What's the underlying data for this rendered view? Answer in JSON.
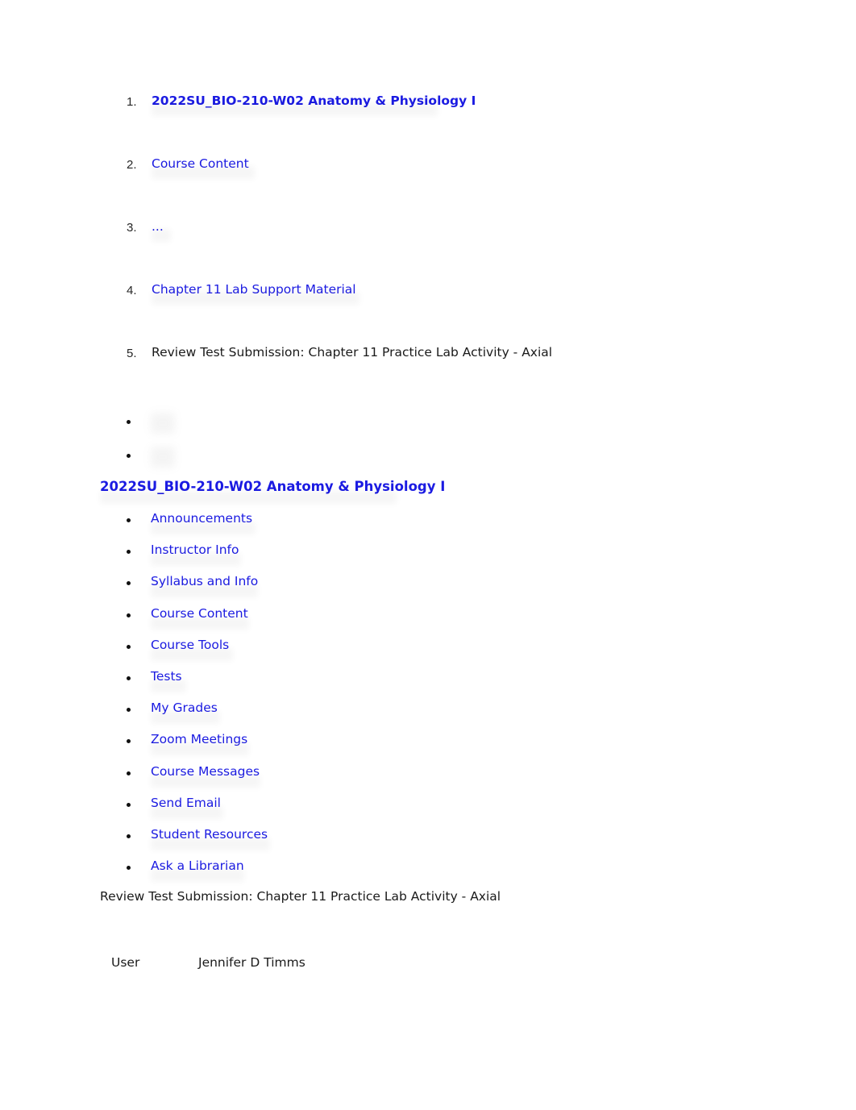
{
  "breadcrumb": {
    "items": [
      {
        "marker": "1.",
        "label": "2022SU_BIO-210-W02 Anatomy & Physiology I",
        "style": "link-bold"
      },
      {
        "marker": "2.",
        "label": "Course Content",
        "style": "link"
      },
      {
        "marker": "3.",
        "label": "...",
        "style": "link"
      },
      {
        "marker": "4.",
        "label": "Chapter 11 Lab Support Material",
        "style": "link"
      },
      {
        "marker": "5.",
        "label": "Review Test Submission: Chapter 11 Practice Lab Activity - Axial",
        "style": "plain"
      }
    ]
  },
  "image_bullets": [
    {
      "icon": "blurred-image-placeholder",
      "label": ""
    },
    {
      "icon": "blurred-image-placeholder",
      "label": ""
    }
  ],
  "course": {
    "heading": "2022SU_BIO-210-W02 Anatomy & Physiology I",
    "menu": [
      {
        "label": "Announcements"
      },
      {
        "label": "Instructor Info"
      },
      {
        "label": "Syllabus and Info"
      },
      {
        "label": "Course Content"
      },
      {
        "label": "Course Tools"
      },
      {
        "label": "Tests"
      },
      {
        "label": "My Grades"
      },
      {
        "label": "Zoom Meetings"
      },
      {
        "label": "Course Messages"
      },
      {
        "label": "Send Email"
      },
      {
        "label": "Student Resources"
      },
      {
        "label": "Ask a Librarian"
      }
    ]
  },
  "submission": {
    "title": "Review Test Submission: Chapter 11 Practice Lab Activity - Axial",
    "details": [
      {
        "key": "User",
        "value": "Jennifer D Timms"
      }
    ]
  },
  "colors": {
    "link": "#1b1be2",
    "text": "#1a1a1a",
    "background": "#ffffff"
  }
}
